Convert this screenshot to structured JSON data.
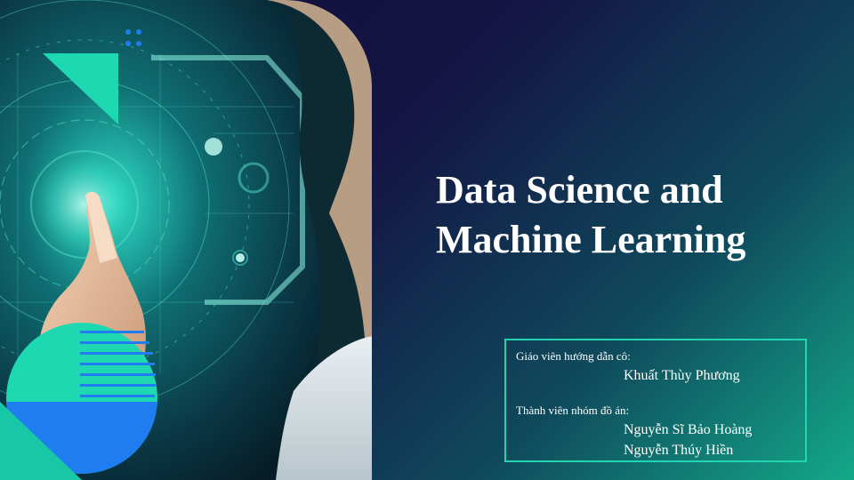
{
  "slide": {
    "title_line1": "Data Science and",
    "title_line2": "Machine Learning",
    "supervisor_label": "Giáo viên hướng dẫn cô:",
    "supervisor_name": "Khuất Thùy Phương",
    "members_label": "Thành viên nhóm đồ án:",
    "members": [
      "Nguyễn Sĩ Bảo Hoàng",
      "Nguyễn Thúy Hiền"
    ]
  },
  "colors": {
    "background_dark": "#130c38",
    "accent_teal": "#23d4b0",
    "accent_blue": "#1f7df0",
    "title_text": "#ffffff"
  }
}
